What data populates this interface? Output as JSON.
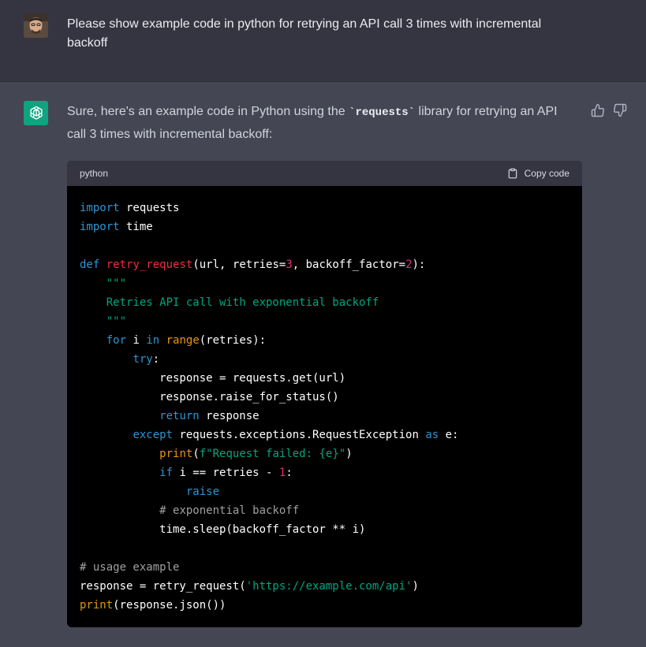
{
  "conversation": {
    "user_message": "Please show example code in python for retrying an API call 3 times with incremental backoff",
    "assistant_intro_before": "Sure, here's an example code in Python using the ",
    "assistant_intro_code": "`requests`",
    "assistant_intro_after": " library for retrying an API call 3 times with incremental backoff:"
  },
  "code_block": {
    "language": "python",
    "copy_label": "Copy code",
    "lines": [
      [
        {
          "t": "kw",
          "v": "import"
        },
        {
          "t": "plain",
          "v": " requests"
        }
      ],
      [
        {
          "t": "kw",
          "v": "import"
        },
        {
          "t": "plain",
          "v": " time"
        }
      ],
      [],
      [
        {
          "t": "kw",
          "v": "def"
        },
        {
          "t": "plain",
          "v": " "
        },
        {
          "t": "fn",
          "v": "retry_request"
        },
        {
          "t": "plain",
          "v": "(url, retries="
        },
        {
          "t": "num",
          "v": "3"
        },
        {
          "t": "plain",
          "v": ", backoff_factor="
        },
        {
          "t": "num",
          "v": "2"
        },
        {
          "t": "plain",
          "v": "):"
        }
      ],
      [
        {
          "t": "plain",
          "v": "    "
        },
        {
          "t": "str",
          "v": "\"\"\""
        }
      ],
      [
        {
          "t": "str",
          "v": "    Retries API call with exponential backoff"
        }
      ],
      [
        {
          "t": "str",
          "v": "    \"\"\""
        }
      ],
      [
        {
          "t": "plain",
          "v": "    "
        },
        {
          "t": "kw",
          "v": "for"
        },
        {
          "t": "plain",
          "v": " i "
        },
        {
          "t": "kw",
          "v": "in"
        },
        {
          "t": "plain",
          "v": " "
        },
        {
          "t": "builtin",
          "v": "range"
        },
        {
          "t": "plain",
          "v": "(retries):"
        }
      ],
      [
        {
          "t": "plain",
          "v": "        "
        },
        {
          "t": "kw",
          "v": "try"
        },
        {
          "t": "plain",
          "v": ":"
        }
      ],
      [
        {
          "t": "plain",
          "v": "            response = requests.get(url)"
        }
      ],
      [
        {
          "t": "plain",
          "v": "            response.raise_for_status()"
        }
      ],
      [
        {
          "t": "plain",
          "v": "            "
        },
        {
          "t": "kw",
          "v": "return"
        },
        {
          "t": "plain",
          "v": " response"
        }
      ],
      [
        {
          "t": "plain",
          "v": "        "
        },
        {
          "t": "kw",
          "v": "except"
        },
        {
          "t": "plain",
          "v": " requests.exceptions.RequestException "
        },
        {
          "t": "kw",
          "v": "as"
        },
        {
          "t": "plain",
          "v": " e:"
        }
      ],
      [
        {
          "t": "plain",
          "v": "            "
        },
        {
          "t": "builtin",
          "v": "print"
        },
        {
          "t": "plain",
          "v": "("
        },
        {
          "t": "str",
          "v": "f\"Request failed: {e}\""
        },
        {
          "t": "plain",
          "v": ")"
        }
      ],
      [
        {
          "t": "plain",
          "v": "            "
        },
        {
          "t": "kw",
          "v": "if"
        },
        {
          "t": "plain",
          "v": " i == retries - "
        },
        {
          "t": "num",
          "v": "1"
        },
        {
          "t": "plain",
          "v": ":"
        }
      ],
      [
        {
          "t": "plain",
          "v": "                "
        },
        {
          "t": "kw",
          "v": "raise"
        }
      ],
      [
        {
          "t": "plain",
          "v": "            "
        },
        {
          "t": "com",
          "v": "# exponential backoff"
        }
      ],
      [
        {
          "t": "plain",
          "v": "            time.sleep(backoff_factor ** i)"
        }
      ],
      [],
      [
        {
          "t": "com",
          "v": "# usage example"
        }
      ],
      [
        {
          "t": "plain",
          "v": "response = retry_request("
        },
        {
          "t": "str",
          "v": "'https://example.com/api'"
        },
        {
          "t": "plain",
          "v": ")"
        }
      ],
      [
        {
          "t": "builtin",
          "v": "print"
        },
        {
          "t": "plain",
          "v": "(response.json())"
        }
      ]
    ]
  },
  "icons": {
    "bot": "openai-logo-icon",
    "thumbs_up": "thumbs-up-icon",
    "thumbs_down": "thumbs-down-icon",
    "copy": "clipboard-icon"
  },
  "colors": {
    "user_bg": "#343541",
    "assistant_bg": "#444654",
    "bot_accent": "#10a37f",
    "code_bg": "#000000"
  }
}
